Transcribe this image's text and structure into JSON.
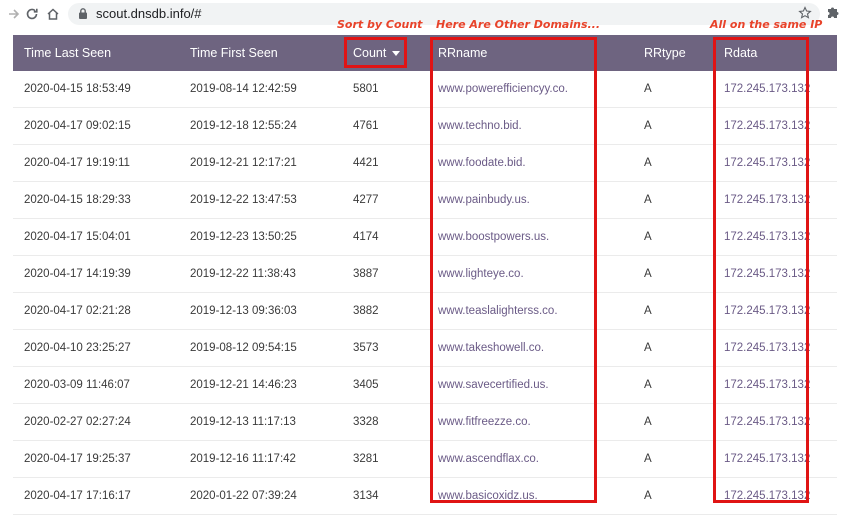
{
  "browser": {
    "url": "scout.dnsdb.info/#"
  },
  "annotations": {
    "sort": "Sort by Count",
    "domains": "Here Are Other Domains...",
    "ip": "All on the same IP"
  },
  "table": {
    "headers": {
      "last_seen": "Time Last Seen",
      "first_seen": "Time First Seen",
      "count": "Count",
      "rrname": "RRname",
      "rrtype": "RRtype",
      "rdata": "Rdata"
    },
    "rows": [
      {
        "last": "2020-04-15 18:53:49",
        "first": "2019-08-14 12:42:59",
        "count": "5801",
        "rrname": "www.powerefficiencyy.co.",
        "rrtype": "A",
        "rdata": "172.245.173.132"
      },
      {
        "last": "2020-04-17 09:02:15",
        "first": "2019-12-18 12:55:24",
        "count": "4761",
        "rrname": "www.techno.bid.",
        "rrtype": "A",
        "rdata": "172.245.173.132"
      },
      {
        "last": "2020-04-17 19:19:11",
        "first": "2019-12-21 12:17:21",
        "count": "4421",
        "rrname": "www.foodate.bid.",
        "rrtype": "A",
        "rdata": "172.245.173.132"
      },
      {
        "last": "2020-04-15 18:29:33",
        "first": "2019-12-22 13:47:53",
        "count": "4277",
        "rrname": "www.painbudy.us.",
        "rrtype": "A",
        "rdata": "172.245.173.132"
      },
      {
        "last": "2020-04-17 15:04:01",
        "first": "2019-12-23 13:50:25",
        "count": "4174",
        "rrname": "www.boostpowers.us.",
        "rrtype": "A",
        "rdata": "172.245.173.132"
      },
      {
        "last": "2020-04-17 14:19:39",
        "first": "2019-12-22 11:38:43",
        "count": "3887",
        "rrname": "www.lighteye.co.",
        "rrtype": "A",
        "rdata": "172.245.173.132"
      },
      {
        "last": "2020-04-17 02:21:28",
        "first": "2019-12-13 09:36:03",
        "count": "3882",
        "rrname": "www.teaslalighterss.co.",
        "rrtype": "A",
        "rdata": "172.245.173.132"
      },
      {
        "last": "2020-04-10 23:25:27",
        "first": "2019-08-12 09:54:15",
        "count": "3573",
        "rrname": "www.takeshowell.co.",
        "rrtype": "A",
        "rdata": "172.245.173.132"
      },
      {
        "last": "2020-03-09 11:46:07",
        "first": "2019-12-21 14:46:23",
        "count": "3405",
        "rrname": "www.savecertified.us.",
        "rrtype": "A",
        "rdata": "172.245.173.132"
      },
      {
        "last": "2020-02-27 02:27:24",
        "first": "2019-12-13 11:17:13",
        "count": "3328",
        "rrname": "www.fitfreezze.co.",
        "rrtype": "A",
        "rdata": "172.245.173.132"
      },
      {
        "last": "2020-04-17 19:25:37",
        "first": "2019-12-16 11:17:42",
        "count": "3281",
        "rrname": "www.ascendflax.co.",
        "rrtype": "A",
        "rdata": "172.245.173.132"
      },
      {
        "last": "2020-04-17 17:16:17",
        "first": "2020-01-22 07:39:24",
        "count": "3134",
        "rrname": "www.basicoxidz.us.",
        "rrtype": "A",
        "rdata": "172.245.173.132"
      }
    ]
  },
  "colors": {
    "header_bg": "#6e6480",
    "link": "#6a5a86",
    "annotation": "#e01414"
  }
}
